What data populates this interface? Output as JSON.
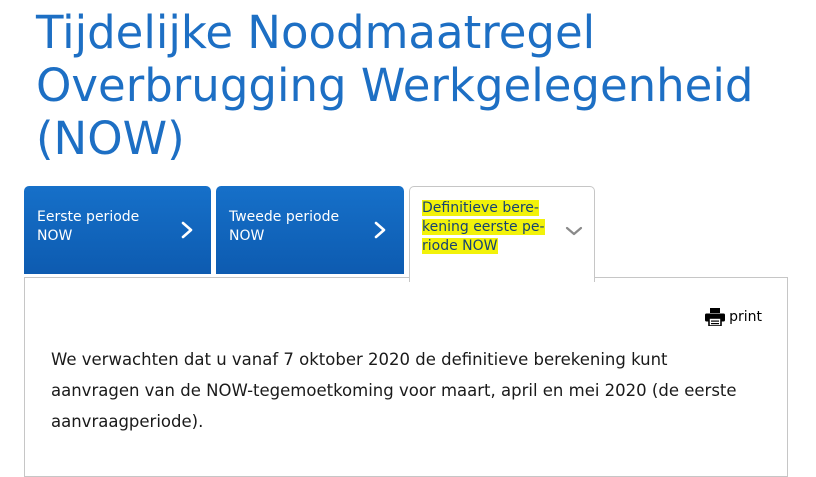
{
  "page": {
    "title": "Tijdelijke Noodmaatregel Overbrugging Werkgelegenheid (NOW)"
  },
  "tabs": [
    {
      "label": "Eerste periode\nNOW",
      "icon": "chevron-right-icon",
      "state": "collapsed"
    },
    {
      "label": "Tweede periode\nNOW",
      "icon": "chevron-right-icon",
      "state": "collapsed"
    },
    {
      "label": "Definitieve bere-\nkening eerste pe-\nriode NOW",
      "icon": "chevron-down-icon",
      "state": "active",
      "highlight": true
    }
  ],
  "panel": {
    "print_label": "print",
    "print_icon": "printer-icon",
    "paragraph": "We verwachten dat u vanaf 7 oktober 2020 de definitieve berekening kunt aanvragen van de NOW-tegemoetkoming voor maart, april en mei 2020 (de eerste aanvraagperiode)."
  },
  "colors": {
    "title": "#1d6fc4",
    "tab_blue": "#0d5bb0",
    "highlight": "#f2f20a",
    "active_tab_text": "#154273"
  }
}
